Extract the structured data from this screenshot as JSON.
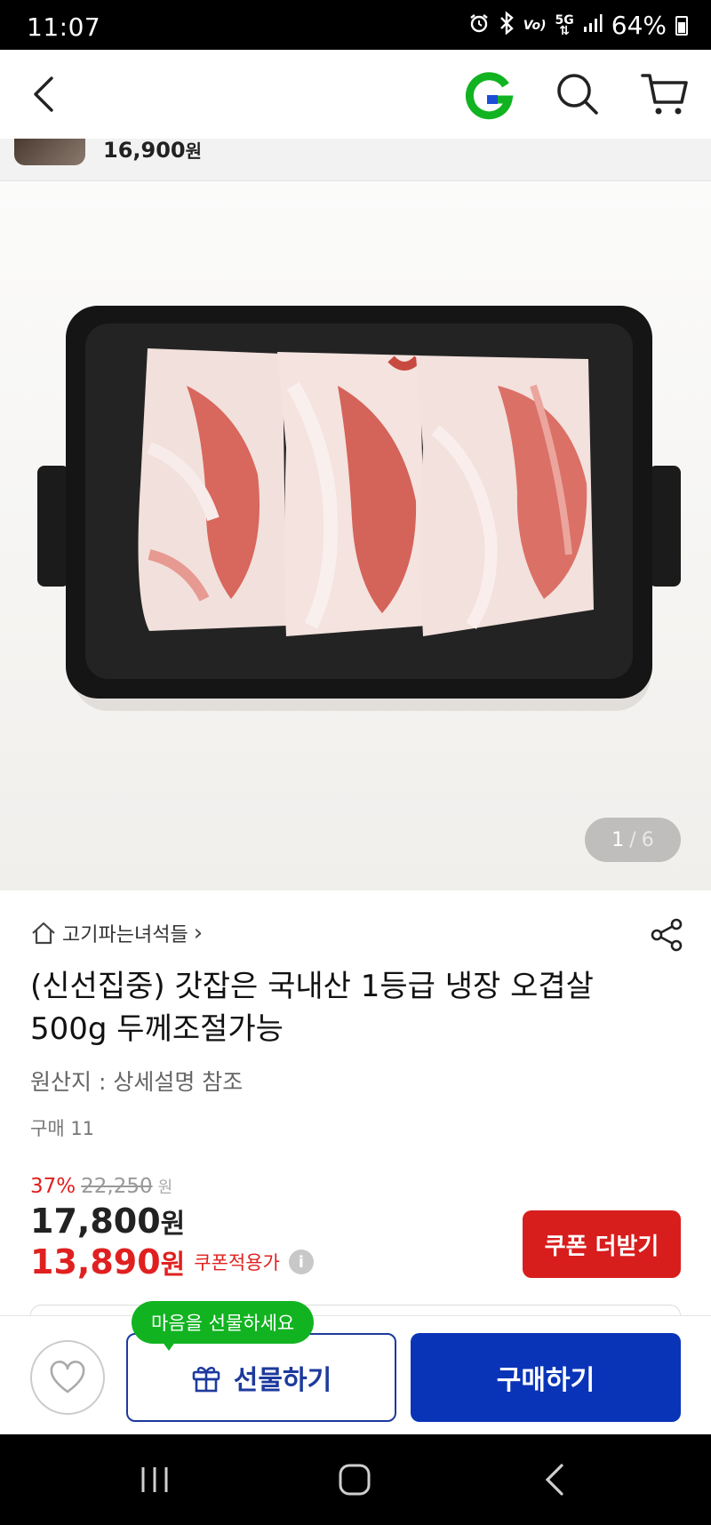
{
  "status_bar": {
    "time": "11:07",
    "battery": "64%",
    "network": "5G",
    "volte": "Vo)",
    "icons": [
      "alarm-icon",
      "bluetooth-icon",
      "volte-icon",
      "5g-icon",
      "signal-icon",
      "battery-icon"
    ]
  },
  "app_bar": {
    "icons": [
      "back-icon",
      "g-logo",
      "search-icon",
      "cart-icon"
    ],
    "brand_color": "#12b321"
  },
  "sticky_strip": {
    "price": "16,900",
    "currency": "원"
  },
  "gallery": {
    "current": "1",
    "separator": "/",
    "total": "6"
  },
  "product": {
    "shop_name": "고기파는녀석들",
    "shop_chevron": "›",
    "title": "(신선집중) 갓잡은 국내산 1등급 냉장 오겹살 500g 두께조절가능",
    "origin": "원산지 : 상세설명 참조",
    "purchase_count": "구매 11"
  },
  "pricing": {
    "discount_rate": "37%",
    "original_price": "22,250",
    "original_currency": "원",
    "sale_price": "17,800",
    "sale_currency": "원",
    "coupon_price": "13,890",
    "coupon_currency": "원",
    "coupon_label": "쿠폰적용가",
    "info_icon": "i",
    "coupon_button": "쿠폰 더받기",
    "accent_color": "#e02020"
  },
  "actions": {
    "tooltip": "마음을 선물하세요",
    "gift_button": "선물하기",
    "buy_button": "구매하기",
    "buy_color": "#0a34b8"
  },
  "nav_bar": {
    "icons": [
      "recents-icon",
      "home-icon",
      "back-icon"
    ]
  }
}
